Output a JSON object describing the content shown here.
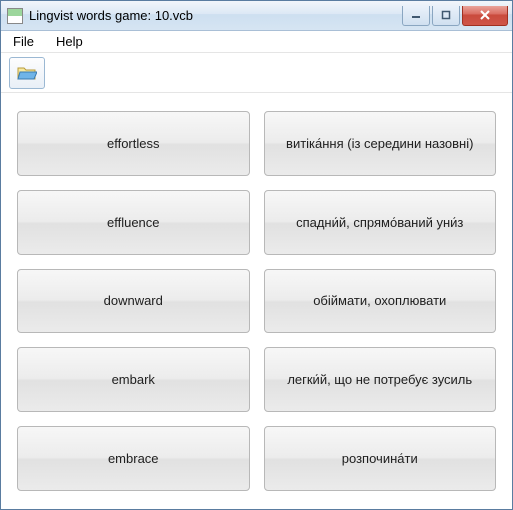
{
  "window": {
    "title": "Lingvist words game: 10.vcb"
  },
  "menu": {
    "file": "File",
    "help": "Help"
  },
  "left": [
    "effortless",
    "effluence",
    "downward",
    "embark",
    "embrace"
  ],
  "right": [
    "витіка́ння (із середини назовні)",
    "спадни́й, спрямо́ваний уни́з",
    "обіймати, охоплювати",
    "легки́й, що не потребує зусиль",
    "розпочина́ти"
  ]
}
